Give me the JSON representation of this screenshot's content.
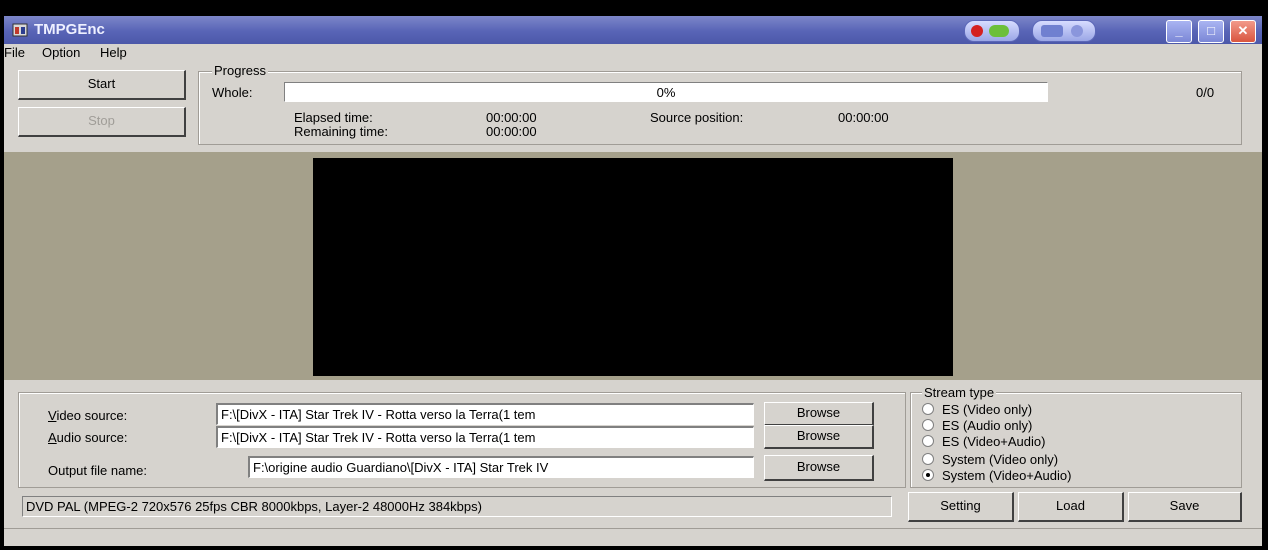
{
  "window": {
    "title": "TMPGEnc",
    "controls": {
      "minimize": "_",
      "maximize": "□",
      "close": "✕"
    }
  },
  "menu": [
    {
      "label": "File"
    },
    {
      "label": "Option"
    },
    {
      "label": "Help"
    }
  ],
  "actions": {
    "start_label": "Start",
    "stop_label": "Stop"
  },
  "progress": {
    "group_title": "Progress",
    "whole_label": "Whole:",
    "percent_text": "0%",
    "percent_value": 0,
    "count_text": "0/0",
    "elapsed_label": "Elapsed time:",
    "elapsed_value": "00:00:00",
    "remaining_label": "Remaining time:",
    "remaining_value": "00:00:00",
    "source_position_label": "Source position:",
    "source_position_value": "00:00:00"
  },
  "sources": {
    "video_label": "Video source:",
    "video_value": "F:\\[DivX - ITA] Star Trek IV - Rotta verso la Terra(1 tem",
    "audio_label": "Audio source:",
    "audio_value": "F:\\[DivX - ITA] Star Trek IV - Rotta verso la Terra(1 tem",
    "output_label": "Output file name:",
    "output_value": "F:\\origine audio Guardiano\\[DivX - ITA] Star Trek IV",
    "browse_label": "Browse"
  },
  "stream_type": {
    "group_title": "Stream type",
    "options": [
      {
        "label": "ES (Video only)",
        "selected": false
      },
      {
        "label": "ES (Audio only)",
        "selected": false
      },
      {
        "label": "ES (Video+Audio)",
        "selected": false
      },
      {
        "label": "System (Video only)",
        "selected": false
      },
      {
        "label": "System (Video+Audio)",
        "selected": true
      }
    ]
  },
  "status": {
    "text": "DVD PAL (MPEG-2 720x576 25fps CBR 8000kbps,  Layer-2 48000Hz 384kbps)"
  },
  "bottom_buttons": {
    "setting_label": "Setting",
    "load_label": "Load",
    "save_label": "Save"
  },
  "colors": {
    "titlebar": "#5864b6",
    "face": "#d6d3ce",
    "preview_bg": "#a5a08b",
    "video": "#000000"
  }
}
